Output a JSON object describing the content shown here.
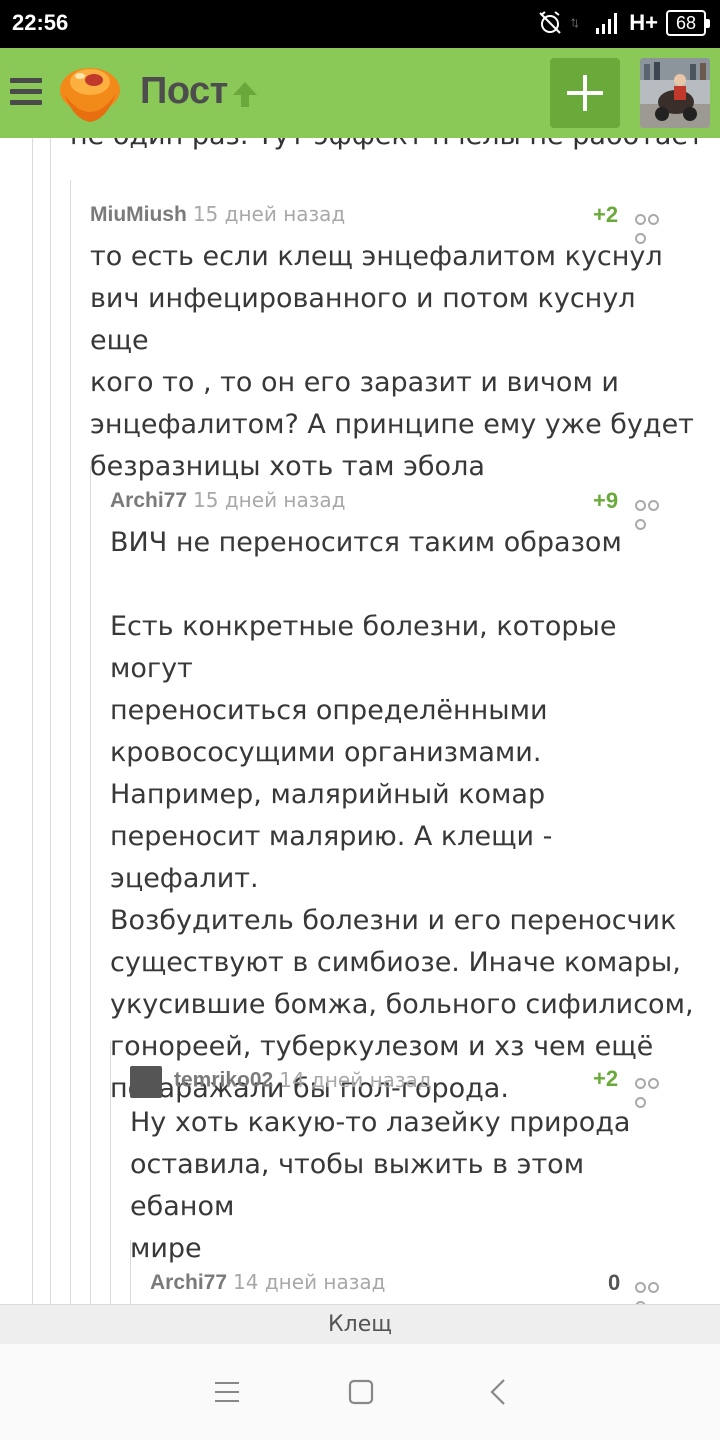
{
  "status_bar": {
    "time": "22:56",
    "network": "H+",
    "battery": "68",
    "icons": [
      "alarm-off-icon",
      "data-arrows-icon",
      "signal-icon"
    ]
  },
  "header": {
    "title": "Пост",
    "icons": [
      "menu-icon",
      "logo-icon",
      "up-arrow-icon",
      "plus-icon"
    ],
    "accent_color": "#8ac858"
  },
  "thread": {
    "cut_text": "не один раз. Тут эффект пчелы не работает",
    "comments": [
      {
        "user": "MiuMiush",
        "time": "15 дней назад",
        "rating": "+2",
        "lines": [
          "то есть если клещ энцефалитом куснул",
          "вич инфецированного и потом куснул еще",
          "кого то , то он его заразит и вичом и",
          "энцефалитом? А принципе ему уже будет",
          "безразницы хоть там эбола"
        ]
      },
      {
        "user": "Archi77",
        "time": "15 дней назад",
        "rating": "+9",
        "lines": [
          "ВИЧ не переносится таким образом",
          "",
          "Есть конкретные болезни, которые могут",
          "переноситься определёнными",
          "кровососущими организмами.",
          "Например, малярийный комар",
          "переносит малярию. А клещи - эцефалит.",
          "Возбудитель болезни и его переносчик",
          "существуют в симбиозе. Иначе комары,",
          "укусившие бомжа, больного сифилисом,",
          "гонореей, туберкулезом и хз чем ещё",
          "позаражали бы пол-города."
        ]
      },
      {
        "user": "temriko02",
        "time": "14 дней назад",
        "rating": "+2",
        "lines": [
          "Ну хоть какую-то лазейку природа",
          "оставила, чтобы выжить в этом ебаном",
          "мире"
        ]
      },
      {
        "user": "Archi77",
        "time": "14 дней назад",
        "rating": "0",
        "lines": []
      }
    ]
  },
  "tag_bar": {
    "label": "Клещ"
  },
  "nav_bar": {
    "icons": [
      "menu-lines-icon",
      "home-square-icon",
      "back-chevron-icon"
    ]
  }
}
